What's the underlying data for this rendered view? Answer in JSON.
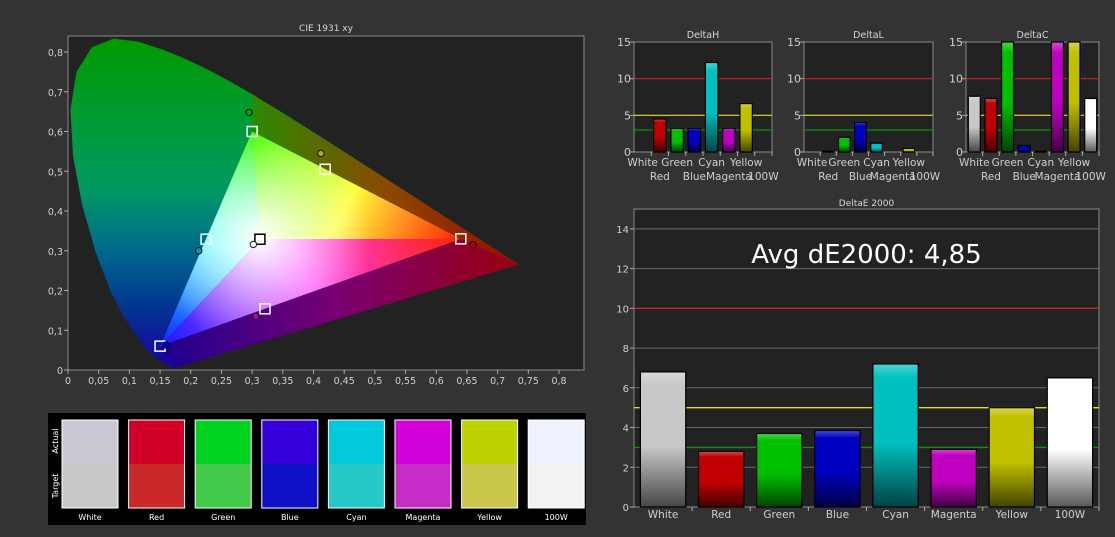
{
  "chart_data": [
    {
      "type": "scatter",
      "title": "CIE 1931 xy",
      "xlim": [
        0,
        0.84
      ],
      "ylim": [
        0,
        0.84
      ],
      "xticks": [
        "0",
        "0,05",
        "0,1",
        "0,15",
        "0,2",
        "0,25",
        "0,3",
        "0,35",
        "0,4",
        "0,45",
        "0,5",
        "0,55",
        "0,6",
        "0,65",
        "0,7",
        "0,75",
        "0,8"
      ],
      "yticks": [
        "0",
        "0,1",
        "0,2",
        "0,3",
        "0,4",
        "0,5",
        "0,6",
        "0,7",
        "0,8"
      ],
      "targets": [
        {
          "name": "Red",
          "x": 0.64,
          "y": 0.33
        },
        {
          "name": "Green",
          "x": 0.3,
          "y": 0.6
        },
        {
          "name": "Blue",
          "x": 0.15,
          "y": 0.06
        },
        {
          "name": "White",
          "x": 0.3127,
          "y": 0.329
        },
        {
          "name": "Cyan",
          "x": 0.225,
          "y": 0.329
        },
        {
          "name": "Magenta",
          "x": 0.321,
          "y": 0.154
        },
        {
          "name": "Yellow",
          "x": 0.419,
          "y": 0.505
        }
      ],
      "measured": [
        {
          "name": "Red",
          "x": 0.66,
          "y": 0.315,
          "color": "#c00000"
        },
        {
          "name": "Green",
          "x": 0.295,
          "y": 0.648,
          "color": "#00a000"
        },
        {
          "name": "Blue",
          "x": 0.16,
          "y": 0.063,
          "color": "#0000c0"
        },
        {
          "name": "White",
          "x": 0.302,
          "y": 0.316,
          "color": "#ffffff"
        },
        {
          "name": "Cyan",
          "x": 0.213,
          "y": 0.3,
          "color": "#00a0a0"
        },
        {
          "name": "Magenta",
          "x": 0.306,
          "y": 0.135,
          "color": "#b000b0"
        },
        {
          "name": "Yellow",
          "x": 0.412,
          "y": 0.545,
          "color": "#b0b000"
        }
      ]
    },
    {
      "type": "bar",
      "title": "DeltaH",
      "ylim": [
        0,
        15
      ],
      "yticks": [
        "0",
        "5",
        "10",
        "15"
      ],
      "categories": [
        "White",
        "Red",
        "Green",
        "Blue",
        "Cyan",
        "Magenta",
        "Yellow",
        "100W"
      ],
      "values": [
        0,
        4.5,
        3.2,
        3.2,
        12.2,
        3.2,
        6.6,
        0
      ]
    },
    {
      "type": "bar",
      "title": "DeltaL",
      "ylim": [
        0,
        15
      ],
      "yticks": [
        "0",
        "5",
        "10",
        "15"
      ],
      "categories": [
        "White",
        "Red",
        "Green",
        "Blue",
        "Cyan",
        "Magenta",
        "Yellow",
        "100W"
      ],
      "values": [
        0,
        0.1,
        2.0,
        4.0,
        1.2,
        0,
        0.5,
        0
      ]
    },
    {
      "type": "bar",
      "title": "DeltaC",
      "ylim": [
        0,
        15
      ],
      "yticks": [
        "0",
        "5",
        "10",
        "15"
      ],
      "categories": [
        "White",
        "Red",
        "Green",
        "Blue",
        "Cyan",
        "Magenta",
        "Yellow",
        "100W"
      ],
      "values": [
        7.6,
        7.3,
        15,
        0.9,
        0.1,
        15,
        15,
        7.3
      ]
    },
    {
      "type": "bar",
      "title": "DeltaE 2000",
      "ylim": [
        0,
        15
      ],
      "yticks": [
        "0",
        "2",
        "4",
        "6",
        "8",
        "10",
        "12",
        "14"
      ],
      "categories": [
        "White",
        "Red",
        "Green",
        "Blue",
        "Cyan",
        "Magenta",
        "Yellow",
        "100W"
      ],
      "values": [
        6.8,
        2.8,
        3.7,
        3.85,
        7.2,
        2.9,
        5.0,
        6.5
      ],
      "annotation": "Avg dE2000: 4,85"
    }
  ],
  "thresholds": [
    {
      "value": 10,
      "color": "#d02020"
    },
    {
      "value": 5,
      "color": "#e0e020"
    },
    {
      "value": 3,
      "color": "#109010"
    }
  ],
  "bar_colors": [
    "#c8c8c8",
    "#c00000",
    "#00c000",
    "#0000c0",
    "#00c0c0",
    "#c000c0",
    "#c0c000",
    "#ffffff"
  ],
  "swatches": {
    "actual_label": "Actual",
    "target_label": "Target",
    "items": [
      {
        "name": "White",
        "actual": "#c8c9d3",
        "target": "#c8c8c8"
      },
      {
        "name": "Red",
        "actual": "#d20028",
        "target": "#c82828"
      },
      {
        "name": "Green",
        "actual": "#00d420",
        "target": "#42ca4a"
      },
      {
        "name": "Blue",
        "actual": "#3400dc",
        "target": "#1010c6"
      },
      {
        "name": "Cyan",
        "actual": "#00cadc",
        "target": "#26c8c8"
      },
      {
        "name": "Magenta",
        "actual": "#d000d8",
        "target": "#c62cc6"
      },
      {
        "name": "Yellow",
        "actual": "#bed200",
        "target": "#cac84a"
      },
      {
        "name": "100W",
        "actual": "#eef2fe",
        "target": "#f2f2f2"
      }
    ]
  }
}
